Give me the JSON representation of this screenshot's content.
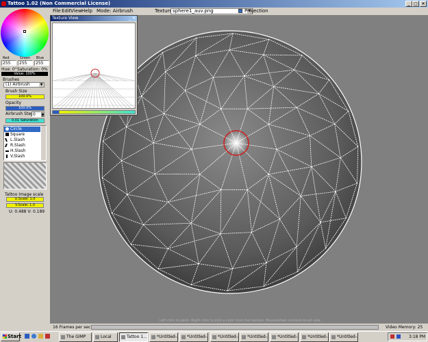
{
  "window": {
    "title": "Tattoo 1.02 (Non Commercial License)",
    "min": "_",
    "max": "□",
    "close": "×"
  },
  "menu": {
    "items": [
      "File",
      "Edit",
      "View",
      "Help"
    ],
    "mode": "Mode: Airbrush",
    "texture_label": "Texture:",
    "texture_value": "sphere1_auv.png",
    "projection_label": "Projection"
  },
  "color": {
    "red_label": "Red",
    "green_label": "Green",
    "blue_label": "Blue",
    "red": "255",
    "green": "255",
    "blue": "255",
    "hue": "Hue: 0°",
    "saturation": "Saturation: 0%",
    "value": "Value: 100%"
  },
  "brushes": {
    "label": "Brushes",
    "selected": "(1) Airbrush",
    "size_label": "Brush Size",
    "size_value": "100.0%",
    "opacity_label": "Opacity",
    "opacity_value": "100.0%",
    "step_label": "Airbrush Step",
    "step_value": "0",
    "bottom_value": "0.01 Saturation"
  },
  "shapes": [
    "Circle",
    "Square",
    "L.Slash",
    "R.Slash",
    "H.Slash",
    "V.Slash"
  ],
  "scale": {
    "label": "Tattoo Image scale",
    "u": "U.Scale: 1.0",
    "v": "V.Scale: 1.0",
    "uv": "U: 0.488 V: 0.189"
  },
  "texture_view": {
    "title": "Texture View",
    "close": "×",
    "min": "_"
  },
  "status": {
    "fps": "16 Frames per sec.",
    "hint": "Left click to paint. Right click to pick a color from the texture. Mousewheel controls brush size.",
    "memory": "Video Memory: 25 Meg."
  },
  "taskbar": {
    "start": "Start",
    "items": [
      "The GIMP",
      "Local",
      "Tattoo 1...",
      "*Untitled-...",
      "*Untitled-...",
      "*Untitled-...",
      "*Untitled-...",
      "*Untitled-...",
      "*Untitled-...",
      "*Untitled-..."
    ],
    "clock": "3:18 PM"
  },
  "colors": {
    "accent_title": "#0a246a",
    "selection": "#316ac5",
    "brush_ring": "#cc2222"
  }
}
